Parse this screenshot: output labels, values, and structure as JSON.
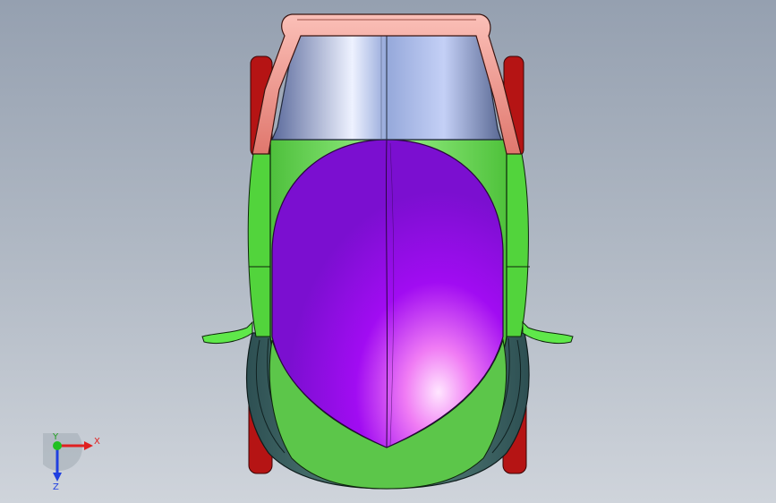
{
  "viewport": {
    "background_top": "#95a0b0",
    "background_bottom": "#cfd4db"
  },
  "model": {
    "colors": {
      "roll_bar": "#f08f88",
      "windshield": "#aebce8",
      "hood": "#9c08f2",
      "body": "#5fe84a",
      "lower_body": "#3c6a6c",
      "wheels": "#b51414"
    }
  },
  "triad": {
    "x_label": "X",
    "y_label": "Y",
    "z_label": "Z",
    "x_color": "#e02020",
    "y_color": "#20c020",
    "z_color": "#2040e0"
  }
}
